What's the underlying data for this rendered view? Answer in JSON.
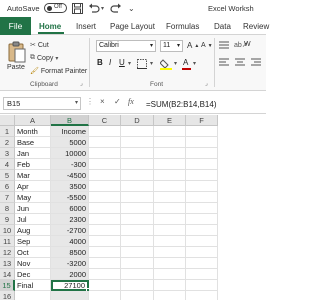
{
  "titlebar": {
    "autosave_label": "AutoSave",
    "autosave_state": "Off",
    "window_title": "Excel Worksh"
  },
  "tabs": [
    "File",
    "Home",
    "Insert",
    "Page Layout",
    "Formulas",
    "Data",
    "Review"
  ],
  "ribbon": {
    "paste_label": "Paste",
    "cut_label": "Cut",
    "copy_label": "Copy",
    "format_painter_label": "Format Painter",
    "clipboard_group": "Clipboard",
    "font_name": "Calibri",
    "font_size": "11",
    "bold": "B",
    "italic": "I",
    "underline": "U",
    "font_group": "Font",
    "wrap_label": "W",
    "font_color": "#c00000",
    "accent_color": "#217346"
  },
  "formula_bar": {
    "cell_ref": "B15",
    "cancel_symbol": "×",
    "enter_symbol": "✓",
    "fx_symbol": "fx",
    "formula": "=SUM(B2:B14,B14)"
  },
  "grid": {
    "columns": [
      "A",
      "B",
      "C",
      "D",
      "E",
      "F"
    ],
    "row_numbers": [
      "1",
      "2",
      "3",
      "4",
      "5",
      "6",
      "7",
      "8",
      "9",
      "10",
      "11",
      "12",
      "13",
      "14",
      "15",
      "16"
    ],
    "active_column": "B",
    "active_row": "15",
    "rows": [
      {
        "a": "Month",
        "b": "Income"
      },
      {
        "a": "Base",
        "b": "5000"
      },
      {
        "a": "Jan",
        "b": "10000"
      },
      {
        "a": "Feb",
        "b": "-300"
      },
      {
        "a": "Mar",
        "b": "-4500"
      },
      {
        "a": "Apr",
        "b": "3500"
      },
      {
        "a": "May",
        "b": "-5500"
      },
      {
        "a": "Jun",
        "b": "6000"
      },
      {
        "a": "Jul",
        "b": "2300"
      },
      {
        "a": "Aug",
        "b": "-2700"
      },
      {
        "a": "Sep",
        "b": "4000"
      },
      {
        "a": "Oct",
        "b": "8500"
      },
      {
        "a": "Nov",
        "b": "-3200"
      },
      {
        "a": "Dec",
        "b": "2000"
      },
      {
        "a": "Final",
        "b": "27100"
      },
      {
        "a": "",
        "b": ""
      }
    ]
  }
}
